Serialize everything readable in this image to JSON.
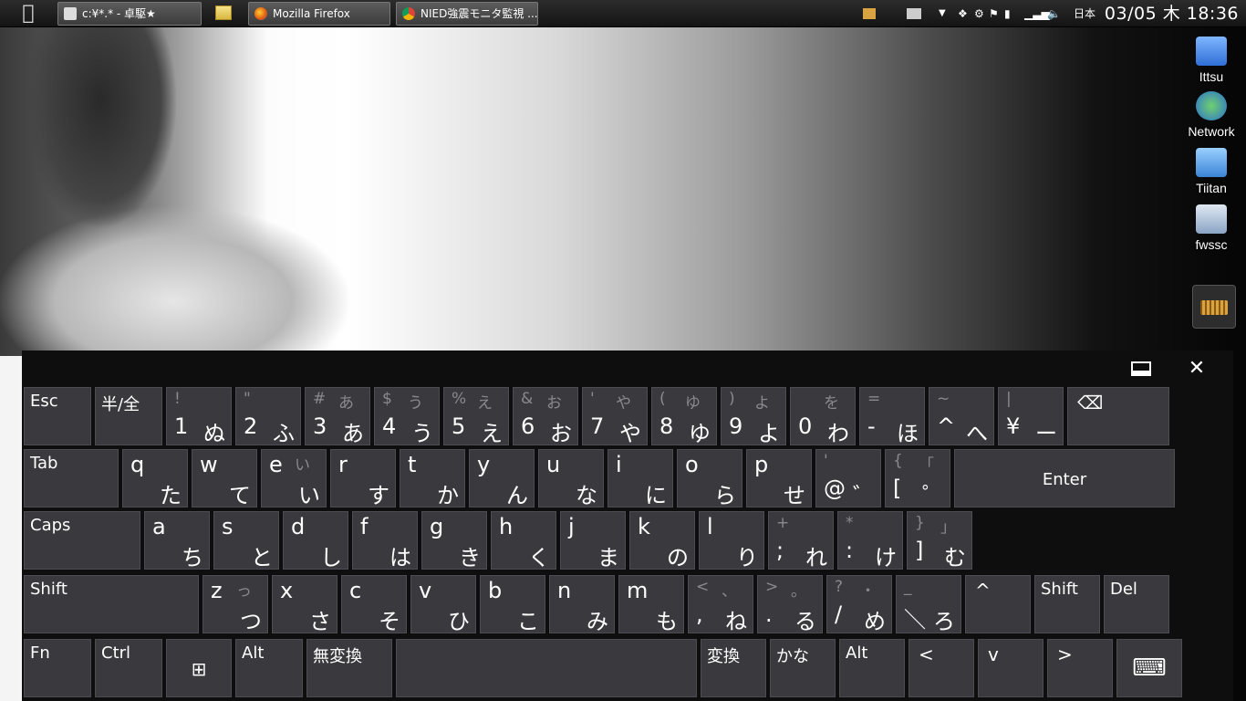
{
  "taskbar": {
    "tasks": [
      {
        "label": "c:¥*.* - 卓駆★"
      },
      {
        "label": "Mozilla Firefox"
      },
      {
        "label": "NIED強震モニタ監視 ..."
      }
    ],
    "language": "日本",
    "clock": "03/05 木 18:36"
  },
  "desktop_icons": [
    {
      "label": "Ittsu"
    },
    {
      "label": "Network"
    },
    {
      "label": "Tiitan"
    },
    {
      "label": "fwssc"
    }
  ],
  "edge_text": "t",
  "keyboard": {
    "rows": [
      [
        {
          "main": "Esc"
        },
        {
          "main": "半/全"
        },
        {
          "top": "!",
          "topk": "",
          "low": "1",
          "kana": "ぬ"
        },
        {
          "top": "\"",
          "topk": "",
          "low": "2",
          "kana": "ふ"
        },
        {
          "top": "#",
          "topk": "あ",
          "low": "3",
          "kana": "あ"
        },
        {
          "top": "$",
          "topk": "う",
          "low": "4",
          "kana": "う"
        },
        {
          "top": "%",
          "topk": "え",
          "low": "5",
          "kana": "え"
        },
        {
          "top": "&",
          "topk": "お",
          "low": "6",
          "kana": "お"
        },
        {
          "top": "'",
          "topk": "や",
          "low": "7",
          "kana": "や"
        },
        {
          "top": "(",
          "topk": "ゆ",
          "low": "8",
          "kana": "ゆ"
        },
        {
          "top": ")",
          "topk": "よ",
          "low": "9",
          "kana": "よ"
        },
        {
          "top": "",
          "topk": "を",
          "low": "0",
          "kana": "わ"
        },
        {
          "top": "=",
          "topk": "",
          "low": "-",
          "kana": "ほ"
        },
        {
          "top": "~",
          "topk": "",
          "low": "^",
          "kana": "へ"
        },
        {
          "top": "|",
          "topk": "",
          "low": "¥",
          "kana": "ー"
        },
        {
          "main": "⌫"
        }
      ],
      [
        {
          "main": "Tab"
        },
        {
          "top": "q",
          "topk": "",
          "low": "",
          "kana": "た"
        },
        {
          "top": "w",
          "topk": "",
          "low": "",
          "kana": "て"
        },
        {
          "top": "e",
          "topk": "い",
          "low": "",
          "kana": "い"
        },
        {
          "top": "r",
          "topk": "",
          "low": "",
          "kana": "す"
        },
        {
          "top": "t",
          "topk": "",
          "low": "",
          "kana": "か"
        },
        {
          "top": "y",
          "topk": "",
          "low": "",
          "kana": "ん"
        },
        {
          "top": "u",
          "topk": "",
          "low": "",
          "kana": "な"
        },
        {
          "top": "i",
          "topk": "",
          "low": "",
          "kana": "に"
        },
        {
          "top": "o",
          "topk": "",
          "low": "",
          "kana": "ら"
        },
        {
          "top": "p",
          "topk": "",
          "low": "",
          "kana": "せ"
        },
        {
          "top": "'",
          "topk": "",
          "low": "@",
          "kana": "゛"
        },
        {
          "top": "{",
          "topk": "「",
          "low": "[",
          "kana": "゜"
        },
        {
          "main": "Enter"
        }
      ],
      [
        {
          "main": "Caps"
        },
        {
          "top": "a",
          "topk": "",
          "low": "",
          "kana": "ち"
        },
        {
          "top": "s",
          "topk": "",
          "low": "",
          "kana": "と"
        },
        {
          "top": "d",
          "topk": "",
          "low": "",
          "kana": "し"
        },
        {
          "top": "f",
          "topk": "",
          "low": "",
          "kana": "は"
        },
        {
          "top": "g",
          "topk": "",
          "low": "",
          "kana": "き"
        },
        {
          "top": "h",
          "topk": "",
          "low": "",
          "kana": "く"
        },
        {
          "top": "j",
          "topk": "",
          "low": "",
          "kana": "ま"
        },
        {
          "top": "k",
          "topk": "",
          "low": "",
          "kana": "の"
        },
        {
          "top": "l",
          "topk": "",
          "low": "",
          "kana": "り"
        },
        {
          "top": "+",
          "topk": "",
          "low": ";",
          "kana": "れ"
        },
        {
          "top": "*",
          "topk": "",
          "low": ":",
          "kana": "け"
        },
        {
          "top": "}",
          "topk": "」",
          "low": "]",
          "kana": "む"
        }
      ],
      [
        {
          "main": "Shift"
        },
        {
          "top": "z",
          "topk": "っ",
          "low": "",
          "kana": "つ"
        },
        {
          "top": "x",
          "topk": "",
          "low": "",
          "kana": "さ"
        },
        {
          "top": "c",
          "topk": "",
          "low": "",
          "kana": "そ"
        },
        {
          "top": "v",
          "topk": "",
          "low": "",
          "kana": "ひ"
        },
        {
          "top": "b",
          "topk": "",
          "low": "",
          "kana": "こ"
        },
        {
          "top": "n",
          "topk": "",
          "low": "",
          "kana": "み"
        },
        {
          "top": "m",
          "topk": "",
          "low": "",
          "kana": "も"
        },
        {
          "top": "<",
          "topk": "、",
          "low": ",",
          "kana": "ね"
        },
        {
          "top": ">",
          "topk": "。",
          "low": ".",
          "kana": "る"
        },
        {
          "top": "?",
          "topk": "・",
          "low": "/",
          "kana": "め"
        },
        {
          "top": "_",
          "topk": "",
          "low": "＼",
          "kana": "ろ"
        },
        {
          "main": "^"
        },
        {
          "main": "Shift"
        },
        {
          "main": "Del"
        }
      ],
      [
        {
          "main": "Fn"
        },
        {
          "main": "Ctrl"
        },
        {
          "main": "⊞"
        },
        {
          "main": "Alt"
        },
        {
          "main": "無変換"
        },
        {
          "main": ""
        },
        {
          "main": "変換"
        },
        {
          "main": "かな"
        },
        {
          "main": "Alt"
        },
        {
          "main": "<"
        },
        {
          "main": "v"
        },
        {
          "main": ">"
        },
        {
          "main": "⌨"
        }
      ]
    ]
  }
}
